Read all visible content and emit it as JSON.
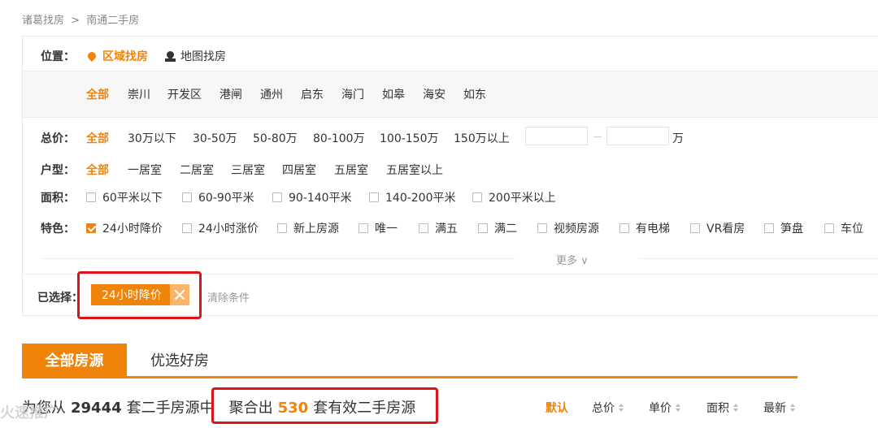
{
  "breadcrumb": {
    "home": "诸葛找房",
    "sep": ">",
    "current": "南通二手房"
  },
  "position": {
    "label": "位置：",
    "tabs": [
      {
        "label": "区域找房",
        "icon": "location-pin-icon"
      },
      {
        "label": "地图找房",
        "icon": "map-icon"
      }
    ],
    "areas": [
      "全部",
      "崇川",
      "开发区",
      "港闸",
      "通州",
      "启东",
      "海门",
      "如皋",
      "海安",
      "如东"
    ]
  },
  "price": {
    "label": "总价：",
    "options": [
      "全部",
      "30万以下",
      "30-50万",
      "50-80万",
      "80-100万",
      "100-150万",
      "150万以上"
    ],
    "min_value": "",
    "max_value": "",
    "unit": "万"
  },
  "layout": {
    "label": "户型：",
    "options": [
      "全部",
      "一居室",
      "二居室",
      "三居室",
      "四居室",
      "五居室",
      "五居室以上"
    ]
  },
  "size": {
    "label": "面积：",
    "options": [
      "60平米以下",
      "60-90平米",
      "90-140平米",
      "140-200平米",
      "200平米以上"
    ]
  },
  "features": {
    "label": "特色：",
    "options": [
      {
        "label": "24小时降价",
        "checked": true
      },
      {
        "label": "24小时涨价",
        "checked": false
      },
      {
        "label": "新上房源",
        "checked": false
      },
      {
        "label": "唯一",
        "checked": false
      },
      {
        "label": "满五",
        "checked": false
      },
      {
        "label": "满二",
        "checked": false
      },
      {
        "label": "视频房源",
        "checked": false
      },
      {
        "label": "有电梯",
        "checked": false
      },
      {
        "label": "VR看房",
        "checked": false
      },
      {
        "label": "笋盘",
        "checked": false
      },
      {
        "label": "车位",
        "checked": false
      }
    ]
  },
  "more_label": "更多 ∨",
  "selected": {
    "label": "已选择：",
    "tag": "24小时降价",
    "clear": "清除条件"
  },
  "tabs": {
    "all": "全部房源",
    "preferred": "优选好房"
  },
  "result": {
    "prefix": "为您从",
    "total": "29444",
    "middle": "套二手房源中",
    "agg": "聚合出",
    "count": "530",
    "suffix": "套有效二手房源"
  },
  "sort": {
    "default": "默认",
    "price": "总价",
    "unit_price": "单价",
    "area": "面积",
    "newest": "最新"
  },
  "watermark": "火速推广",
  "colors": {
    "accent": "#f0840a",
    "highlight": "#d9141a"
  }
}
